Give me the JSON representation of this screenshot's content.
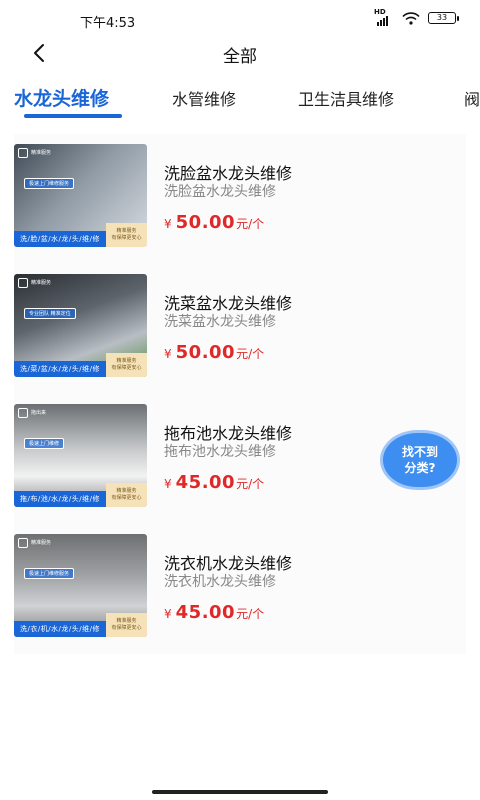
{
  "status": {
    "time": "下午4:53",
    "network": "HD",
    "battery": "33"
  },
  "header": {
    "title": "全部"
  },
  "tabs": [
    {
      "label": "水龙头维修",
      "active": true
    },
    {
      "label": "水管维修",
      "active": false
    },
    {
      "label": "卫生洁具维修",
      "active": false
    },
    {
      "label": "阀",
      "active": false
    }
  ],
  "items": [
    {
      "title": "洗脸盆水龙头维修",
      "subtitle": "洗脸盆水龙头维修",
      "currency": "¥",
      "price": "50.00",
      "unit": "元/个",
      "thumb": {
        "badge": "精准服务",
        "chip": "极速上门维修服务",
        "caption": "洗/脸/盆/水/龙/头/维/修",
        "slogan1": "精准服务",
        "slogan2": "有保障更安心"
      }
    },
    {
      "title": "洗菜盆水龙头维修",
      "subtitle": "洗菜盆水龙头维修",
      "currency": "¥",
      "price": "50.00",
      "unit": "元/个",
      "thumb": {
        "badge": "精准服务",
        "chip": "专业团队 精准定位",
        "caption": "洗/菜/盆/水/龙/头/维/修",
        "slogan1": "精准服务",
        "slogan2": "有保障更安心"
      }
    },
    {
      "title": "拖布池水龙头维修",
      "subtitle": "拖布池水龙头维修",
      "currency": "¥",
      "price": "45.00",
      "unit": "元/个",
      "thumb": {
        "badge": "拖出来",
        "chip": "极速上门维修",
        "caption": "拖/布/池/水/龙/头/维/修",
        "slogan1": "精准服务",
        "slogan2": "有保障更安心"
      }
    },
    {
      "title": "洗衣机水龙头维修",
      "subtitle": "洗衣机水龙头维修",
      "currency": "¥",
      "price": "45.00",
      "unit": "元/个",
      "thumb": {
        "badge": "精准服务",
        "chip": "极速上门维修服务",
        "caption": "洗/衣/机/水/龙/头/维/修",
        "slogan1": "精准服务",
        "slogan2": "有保障更安心"
      }
    }
  ],
  "help": {
    "line1": "找不到",
    "line2": "分类?"
  },
  "colors": {
    "accent": "#1a66d6",
    "price": "#e02828",
    "fab": "#3d8ef0"
  }
}
